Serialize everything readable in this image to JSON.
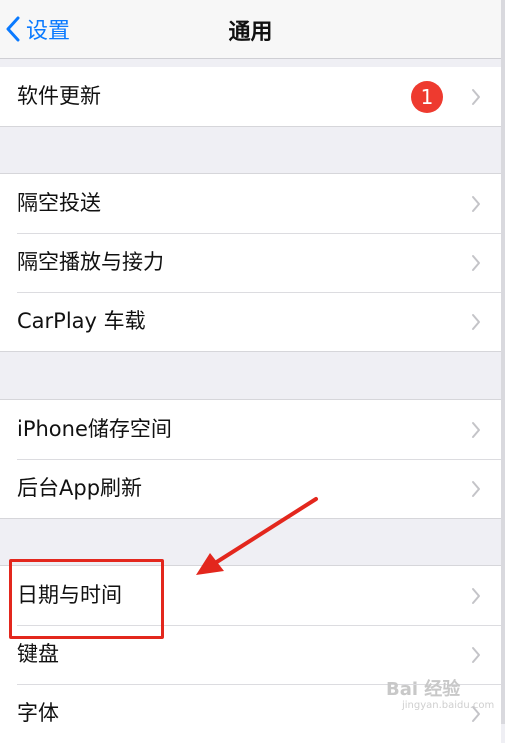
{
  "navbar": {
    "back_label": "设置",
    "title": "通用"
  },
  "groups": [
    {
      "rows": [
        {
          "label": "软件更新",
          "badge": "1"
        }
      ]
    },
    {
      "rows": [
        {
          "label": "隔空投送"
        },
        {
          "label": "隔空播放与接力"
        },
        {
          "label": "CarPlay 车载"
        }
      ]
    },
    {
      "rows": [
        {
          "label": "iPhone储存空间"
        },
        {
          "label": "后台App刷新"
        }
      ]
    },
    {
      "rows": [
        {
          "label": "日期与时间"
        },
        {
          "label": "键盘"
        },
        {
          "label": "字体"
        }
      ]
    }
  ],
  "annotation": {
    "color": "#e3271d"
  },
  "watermark": {
    "text": "Bai 经验",
    "sub": "jingyan.baidu.com"
  },
  "colors": {
    "accent": "#0a7aff",
    "badge": "#ee3a2f",
    "background": "#efeff4"
  }
}
